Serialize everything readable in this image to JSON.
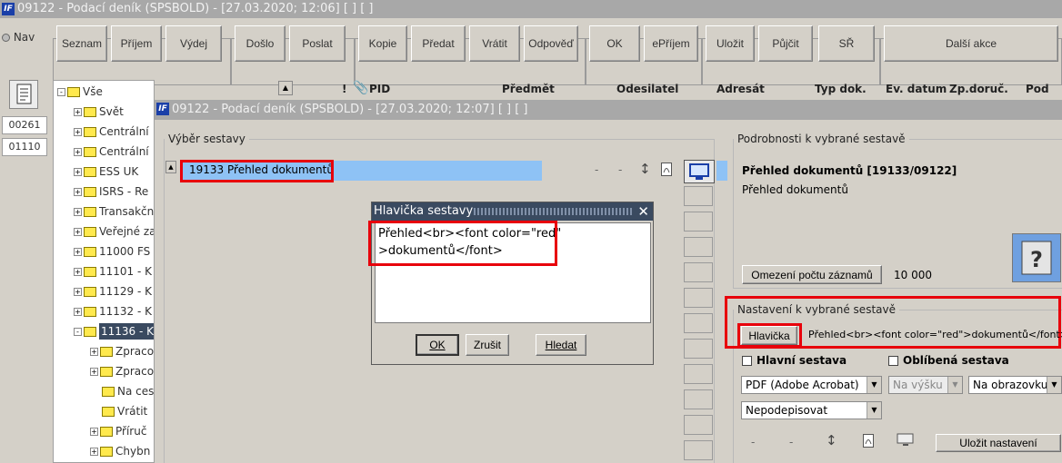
{
  "window": {
    "title": "09122 - Podací deník (SPSBOLD) - [27.03.2020; 12:06]  [ ]  [ ]"
  },
  "nav": {
    "label": "Nav"
  },
  "toolbar": [
    "Seznam",
    "Příjem",
    "Výdej",
    "Došlo",
    "Poslat",
    "Kopie",
    "Předat",
    "Vrátit",
    "Odpověď",
    "OK",
    "ePříjem",
    "Uložit",
    "Půjčit",
    "SŘ",
    "Další akce"
  ],
  "left_counters": [
    "00261",
    "01110"
  ],
  "tree": [
    {
      "label": "Vše",
      "level": 0,
      "sign": "-"
    },
    {
      "label": "Svět",
      "level": 1,
      "sign": "+"
    },
    {
      "label": "Centrální",
      "level": 1,
      "sign": "+"
    },
    {
      "label": "Centrální",
      "level": 1,
      "sign": "+"
    },
    {
      "label": "ESS UK",
      "level": 1,
      "sign": "+"
    },
    {
      "label": "ISRS - Re",
      "level": 1,
      "sign": "+"
    },
    {
      "label": "Transakčn",
      "level": 1,
      "sign": "+"
    },
    {
      "label": "Veřejné za",
      "level": 1,
      "sign": "+"
    },
    {
      "label": "11000 FS",
      "level": 1,
      "sign": "+"
    },
    {
      "label": "11101 - K",
      "level": 1,
      "sign": "+"
    },
    {
      "label": "11129 - K",
      "level": 1,
      "sign": "+"
    },
    {
      "label": "11132 - K",
      "level": 1,
      "sign": "+"
    },
    {
      "label": "11136 - K",
      "level": 1,
      "sign": "-",
      "selected": true
    },
    {
      "label": "Zpraco",
      "level": 2,
      "sign": "+"
    },
    {
      "label": "Zpraco",
      "level": 2,
      "sign": "+"
    },
    {
      "label": "Na ces",
      "level": 2,
      "sign": ""
    },
    {
      "label": "Vrátit",
      "level": 2,
      "sign": ""
    },
    {
      "label": "Příruč",
      "level": 2,
      "sign": "+"
    },
    {
      "label": "Chybn",
      "level": 2,
      "sign": "+"
    }
  ],
  "columns": [
    "!",
    "PID",
    "Předmět",
    "Odesilatel",
    "Adresát",
    "Typ dok.",
    "Ev. datum",
    "Zp.doruč.",
    "Pod"
  ],
  "inner_window": {
    "title": "09122 - Podací deník (SPSBOLD) - [27.03.2020; 12:07]  [ ]  [ ]"
  },
  "selection": {
    "legend": "Výběr sestavy",
    "item_id": "19133",
    "item_name": "Přehled dokumentů",
    "dash1": "-",
    "dash2": "-"
  },
  "details": {
    "legend": "Podrobnosti k vybrané sestavě",
    "title": "Přehled dokumentů [19133/09122]",
    "subtitle": "Přehled dokumentů",
    "limit_button": "Omezení počtu záznamů",
    "limit_value": "10 000"
  },
  "settings": {
    "legend": "Nastavení k vybrané sestavě",
    "header_button": "Hlavička",
    "header_value": "Přehled<br><font color=\"red\">dokumentů</font>",
    "main_report": "Hlavní sestava",
    "favorite_report": "Oblíbená sestava",
    "format": "PDF (Adobe Acrobat)",
    "orientation": "Na výšku",
    "output": "Na obrazovku",
    "signing": "Nepodepisovat",
    "dash1": "-",
    "dash2": "-",
    "save_button": "Uložit nastavení"
  },
  "dialog": {
    "title": "Hlavička sestavy",
    "text": "Přehled<br><font color=\"red\"\n>dokumentů</font>",
    "ok": "OK",
    "cancel": "Zrušit",
    "search": "Hledat"
  },
  "colors": {
    "title_bar": "#a8a8a8",
    "dialog_title": "#3a4a60",
    "highlight": "#e8000b",
    "selection": "#8ec2f5"
  }
}
